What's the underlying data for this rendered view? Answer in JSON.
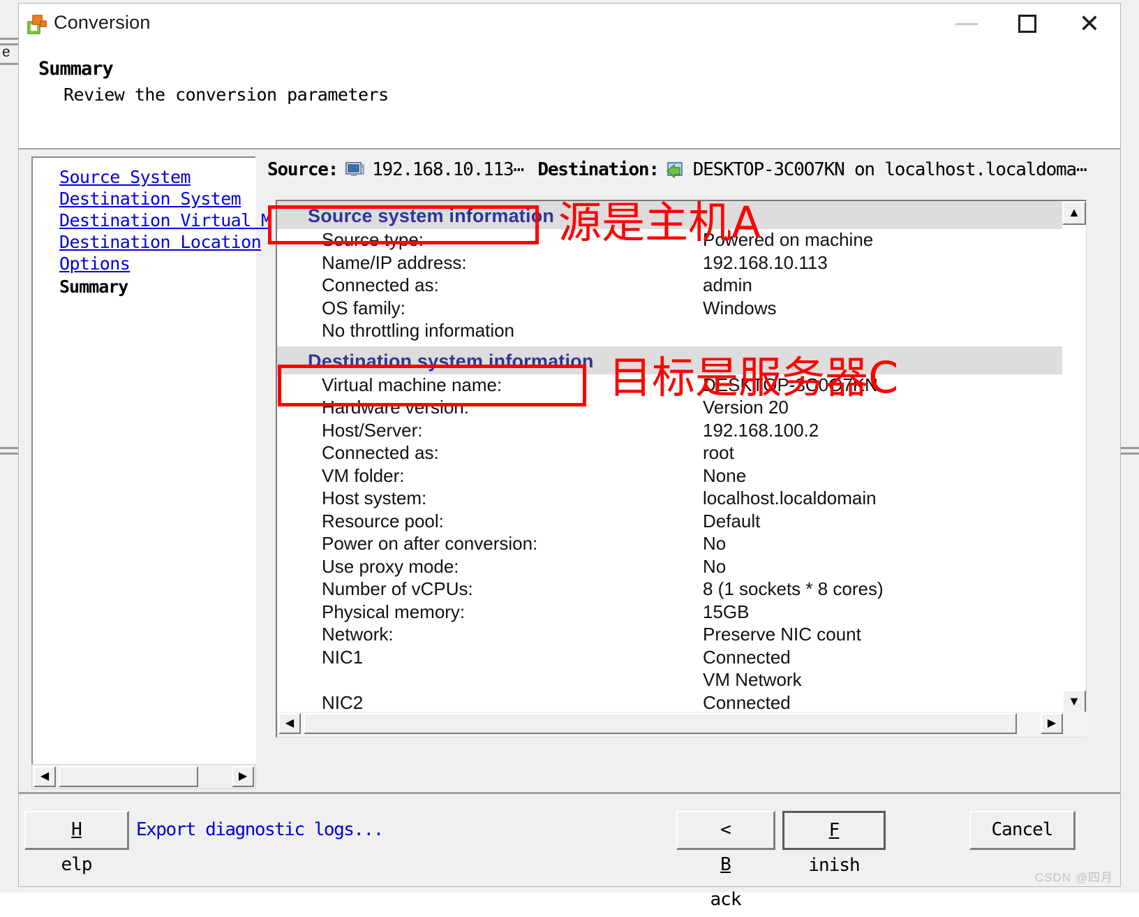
{
  "window": {
    "title": "Conversion",
    "app_icon": "conversion-app-icon",
    "controls": {
      "minimize": "minimize-icon",
      "maximize": "maximize-icon",
      "close": "close-icon"
    }
  },
  "page_header": {
    "title": "Summary",
    "subtitle": "Review the conversion parameters"
  },
  "sidebar": {
    "links": [
      "Source System",
      "Destination System",
      "Destination Virtual M",
      "Destination Location",
      "Options"
    ],
    "current": "Summary",
    "scroll_left": "◀",
    "scroll_right": "▶"
  },
  "context_bar": {
    "source_label": "Source:",
    "source_icon": "monitor-icon",
    "source_value": "192.168.10.113⋯",
    "destination_label": "Destination:",
    "destination_icon": "vm-import-icon",
    "destination_value": "DESKTOP-3C0O7KN on localhost.localdoma⋯"
  },
  "summary": {
    "source_section": {
      "title": "Source system information",
      "rows": [
        {
          "key": "Source type:",
          "value": "Powered on machine"
        },
        {
          "key": "Name/IP address:",
          "value": "192.168.10.113"
        },
        {
          "key": "Connected as:",
          "value": "admin"
        },
        {
          "key": "OS family:",
          "value": "Windows"
        },
        {
          "key": "No throttling information",
          "value": ""
        }
      ]
    },
    "destination_section": {
      "title": "Destination system information",
      "rows": [
        {
          "key": "Virtual machine name:",
          "value": "DESKTOP-3C0O7KN"
        },
        {
          "key": "Hardware version:",
          "value": "Version 20"
        },
        {
          "key": "Host/Server:",
          "value": "192.168.100.2"
        },
        {
          "key": "Connected as:",
          "value": "root"
        },
        {
          "key": "VM folder:",
          "value": "None"
        },
        {
          "key": "Host system:",
          "value": "localhost.localdomain"
        },
        {
          "key": "Resource pool:",
          "value": "Default"
        },
        {
          "key": "Power on after conversion:",
          "value": "No"
        },
        {
          "key": "Use proxy mode:",
          "value": "No"
        },
        {
          "key": "Number of vCPUs:",
          "value": "8 (1 sockets * 8 cores)"
        },
        {
          "key": "Physical memory:",
          "value": "15GB"
        },
        {
          "key": "Network:",
          "value": "Preserve NIC count"
        },
        {
          "key": "NIC1",
          "value": "Connected"
        },
        {
          "key": "",
          "value": "VM Network"
        },
        {
          "key": "NIC2",
          "value": "Connected"
        }
      ]
    },
    "vscroll_up": "▲",
    "vscroll_down": "▼",
    "hscroll_left": "◀",
    "hscroll_right": "▶"
  },
  "annotations": {
    "color": "#ff0000",
    "source_note": "源是主机A",
    "destination_note": "目标是服务器C"
  },
  "footer": {
    "help": "Help",
    "help_accel": "H",
    "export_logs": "Export diagnostic logs...",
    "back": "< Back",
    "back_accel": "B",
    "finish": "Finish",
    "finish_accel": "F",
    "cancel": "Cancel"
  },
  "watermark": "CSDN @四月",
  "background_window": {
    "fragment_glyph": "e"
  }
}
